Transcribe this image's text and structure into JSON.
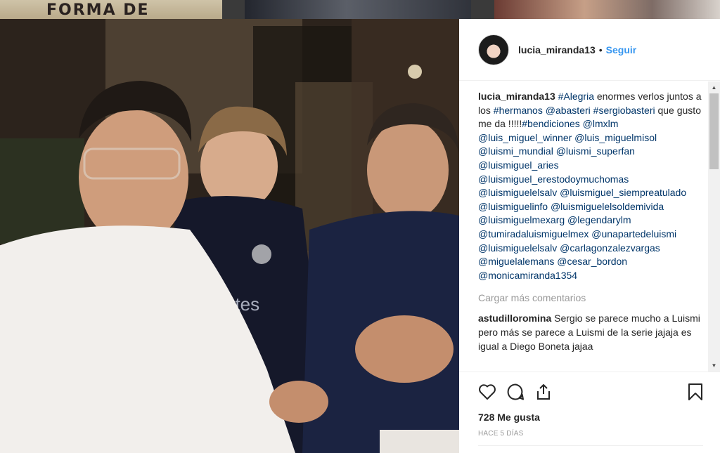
{
  "background_feed": {
    "thumb1_text": "FORMA DE"
  },
  "post": {
    "username": "lucia_miranda13",
    "follow_label": "Seguir",
    "separator": "•",
    "caption": {
      "user": "lucia_miranda13",
      "segments": [
        {
          "t": "tag",
          "v": "#Alegria"
        },
        {
          "t": "text",
          "v": " enormes verlos juntos a los "
        },
        {
          "t": "tag",
          "v": "#hermanos"
        },
        {
          "t": "text",
          "v": " "
        },
        {
          "t": "tag",
          "v": "@abasteri"
        },
        {
          "t": "text",
          "v": " "
        },
        {
          "t": "tag",
          "v": "#sergiobasteri"
        },
        {
          "t": "text",
          "v": " que gusto me da !!!!!"
        },
        {
          "t": "tag",
          "v": "#bendiciones"
        },
        {
          "t": "text",
          "v": " "
        },
        {
          "t": "tag",
          "v": "@lmxlm"
        },
        {
          "t": "text",
          "v": " "
        },
        {
          "t": "tag",
          "v": "@luis_miguel_winner"
        },
        {
          "t": "text",
          "v": " "
        },
        {
          "t": "tag",
          "v": "@luis_miguelmisol"
        },
        {
          "t": "text",
          "v": " "
        },
        {
          "t": "tag",
          "v": "@luismi_mundial"
        },
        {
          "t": "text",
          "v": " "
        },
        {
          "t": "tag",
          "v": "@luismi_superfan"
        },
        {
          "t": "text",
          "v": " "
        },
        {
          "t": "tag",
          "v": "@luismiguel_aries"
        },
        {
          "t": "text",
          "v": " "
        },
        {
          "t": "tag",
          "v": "@luismiguel_erestodoymuchomas"
        },
        {
          "t": "text",
          "v": " "
        },
        {
          "t": "tag",
          "v": "@luismiguelelsalv"
        },
        {
          "t": "text",
          "v": " "
        },
        {
          "t": "tag",
          "v": "@luismiguel_siempreatulado"
        },
        {
          "t": "text",
          "v": " "
        },
        {
          "t": "tag",
          "v": "@luismiguelinfo"
        },
        {
          "t": "text",
          "v": " "
        },
        {
          "t": "tag",
          "v": "@luismiguelelsoldemivida"
        },
        {
          "t": "text",
          "v": " "
        },
        {
          "t": "tag",
          "v": "@luismiguelmexarg"
        },
        {
          "t": "text",
          "v": " "
        },
        {
          "t": "tag",
          "v": "@legendarylm"
        },
        {
          "t": "text",
          "v": " "
        },
        {
          "t": "tag",
          "v": "@tumiradaluismiguelmex"
        },
        {
          "t": "text",
          "v": " "
        },
        {
          "t": "tag",
          "v": "@unapartedeluismi"
        },
        {
          "t": "text",
          "v": " "
        },
        {
          "t": "tag",
          "v": "@luismiguelelsalv"
        },
        {
          "t": "text",
          "v": " "
        },
        {
          "t": "tag",
          "v": "@carlagonzalezvargas"
        },
        {
          "t": "text",
          "v": " "
        },
        {
          "t": "tag",
          "v": "@miguelalemans"
        },
        {
          "t": "text",
          "v": " "
        },
        {
          "t": "tag",
          "v": "@cesar_bordon"
        },
        {
          "t": "text",
          "v": " "
        },
        {
          "t": "tag",
          "v": "@monicamiranda1354"
        }
      ]
    },
    "load_more_label": "Cargar más comentarios",
    "comment": {
      "user": "astudilloromina",
      "text": "Sergio se parece mucho a Luismi pero más se parece a Luismi de la serie jajaja es igual a Diego Boneta jajaa"
    },
    "likes": "728 Me gusta",
    "time_ago": "HACE 5 DÍAS"
  },
  "icons": {
    "like": "heart-icon",
    "comment": "comment-bubble-icon",
    "share": "share-icon",
    "save": "bookmark-icon"
  },
  "colors": {
    "link": "#3897f0",
    "tag": "#003569",
    "text": "#262626",
    "muted": "#999999"
  }
}
